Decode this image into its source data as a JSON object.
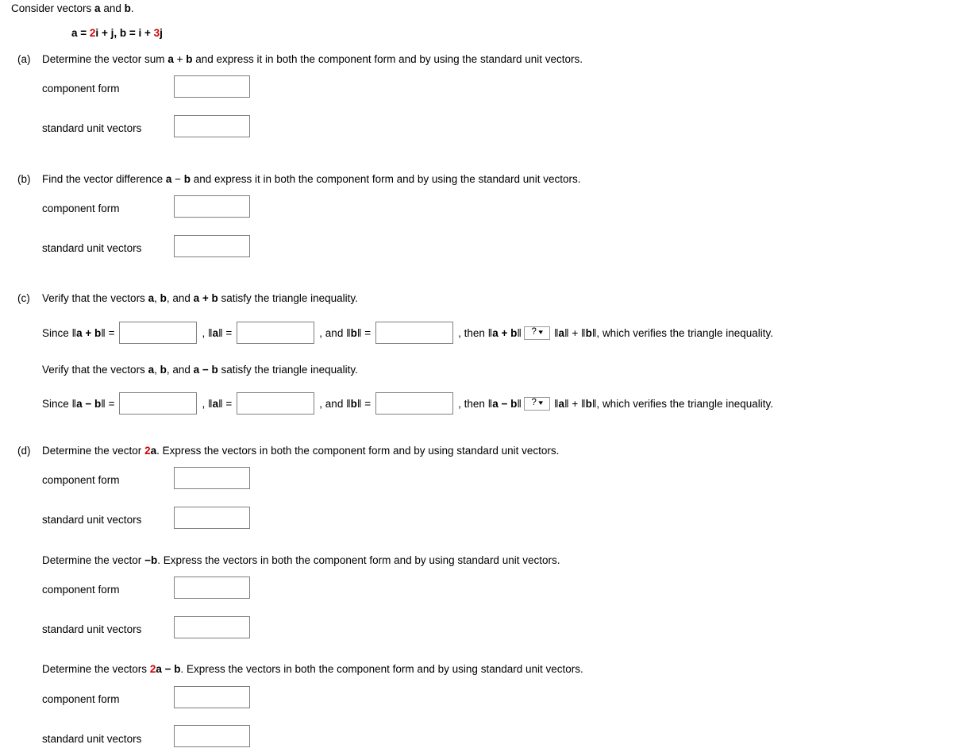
{
  "intro": {
    "lead": "Consider vectors ",
    "vec_a": "a",
    "and": " and ",
    "vec_b": "b",
    "period": "."
  },
  "equation": {
    "a_label": "a",
    "eq1": " = ",
    "a_coeff": "2",
    "a_i": "i",
    "plus": " + ",
    "a_j": "j",
    "comma": ", ",
    "b_label": "b",
    "eq2": " = ",
    "b_i": "i",
    "plus2": " + ",
    "b_coeff": "3",
    "b_j": "j"
  },
  "colors": {
    "accent_red": "#d60000",
    "text": "#000000",
    "box_border": "#808080"
  },
  "field_labels": {
    "component_form": "component form",
    "standard_unit_vectors": "standard unit vectors"
  },
  "parts": {
    "a": {
      "label": "(a)",
      "text_pre": "Determine the vector sum ",
      "vec1": "a",
      "op": " + ",
      "vec2": "b",
      "text_post": " and express it in both the component form and by using the standard unit vectors."
    },
    "b": {
      "label": "(b)",
      "text_pre": "Find the vector difference ",
      "vec1": "a",
      "op": " − ",
      "vec2": "b",
      "text_post": " and express it in both the component form and by using the standard unit vectors."
    },
    "c": {
      "label": "(c)",
      "heading1_pre": "Verify that the vectors ",
      "heading1_a": "a",
      "heading1_sep1": ", ",
      "heading1_b": "b",
      "heading1_sep2": ", and ",
      "heading1_c1": "a",
      "heading1_op": " + ",
      "heading1_c2": "b",
      "heading1_post": " satisfy the triangle inequality.",
      "heading2_pre": "Verify that the vectors ",
      "heading2_a": "a",
      "heading2_sep1": ", ",
      "heading2_b": "b",
      "heading2_sep2": ", and ",
      "heading2_c1": "a",
      "heading2_op": " − ",
      "heading2_c2": "b",
      "heading2_post": " satisfy the triangle inequality.",
      "row1": {
        "since": "Since ‖",
        "n1_v1": "a",
        "n1_op": " + ",
        "n1_v2": "b",
        "since_close": "‖ =",
        "comma1": ", ‖",
        "n2": "a",
        "n2_close": "‖ =",
        "comma2": ", and ‖",
        "n3": "b",
        "n3_close": "‖ =",
        "then": ", then ‖",
        "then_v1": "a",
        "then_op": " + ",
        "then_v2": "b",
        "then_close": "‖",
        "select_value": "?",
        "select_options": [
          "?",
          "<",
          ">",
          "≤",
          "≥",
          "="
        ],
        "tail_pre": "‖",
        "tail_a": "a",
        "tail_mid": "‖ + ‖",
        "tail_b": "b",
        "tail_post": "‖, which verifies the triangle inequality."
      },
      "row2": {
        "since": "Since ‖",
        "n1_v1": "a",
        "n1_op": " − ",
        "n1_v2": "b",
        "since_close": "‖ =",
        "comma1": ", ‖",
        "n2": "a",
        "n2_close": "‖ =",
        "comma2": ", and ‖",
        "n3": "b",
        "n3_close": "‖ =",
        "then": ", then ‖",
        "then_v1": "a",
        "then_op": " − ",
        "then_v2": "b",
        "then_close": "‖",
        "select_value": "?",
        "select_options": [
          "?",
          "<",
          ">",
          "≤",
          "≥",
          "="
        ],
        "tail_pre": "‖",
        "tail_a": "a",
        "tail_mid": "‖ + ‖",
        "tail_b": "b",
        "tail_post": "‖, which verifies the triangle inequality."
      }
    },
    "d": {
      "label": "(d)",
      "sub1_pre": "Determine the vector ",
      "sub1_coeff": "2",
      "sub1_vec": "a",
      "sub1_post": ". Express the vectors in both the component form and by using standard unit vectors.",
      "sub2_pre": "Determine the vector ",
      "sub2_sign": "−",
      "sub2_vec": "b",
      "sub2_post": ". Express the vectors in both the component form and by using standard unit vectors.",
      "sub3_pre": "Determine the vectors ",
      "sub3_coeff": "2",
      "sub3_vec1": "a",
      "sub3_op": " − ",
      "sub3_vec2": "b",
      "sub3_post": ". Express the vectors in both the component form and by using standard unit vectors."
    }
  },
  "inputs": {
    "a_component_form": "",
    "a_standard_unit_vectors": "",
    "b_component_form": "",
    "b_standard_unit_vectors": "",
    "c_row1_norm_sum": "",
    "c_row1_norm_a": "",
    "c_row1_norm_b": "",
    "c_row2_norm_diff": "",
    "c_row2_norm_a": "",
    "c_row2_norm_b": "",
    "d1_component_form": "",
    "d1_standard_unit_vectors": "",
    "d2_component_form": "",
    "d2_standard_unit_vectors": "",
    "d3_component_form": "",
    "d3_standard_unit_vectors": ""
  }
}
